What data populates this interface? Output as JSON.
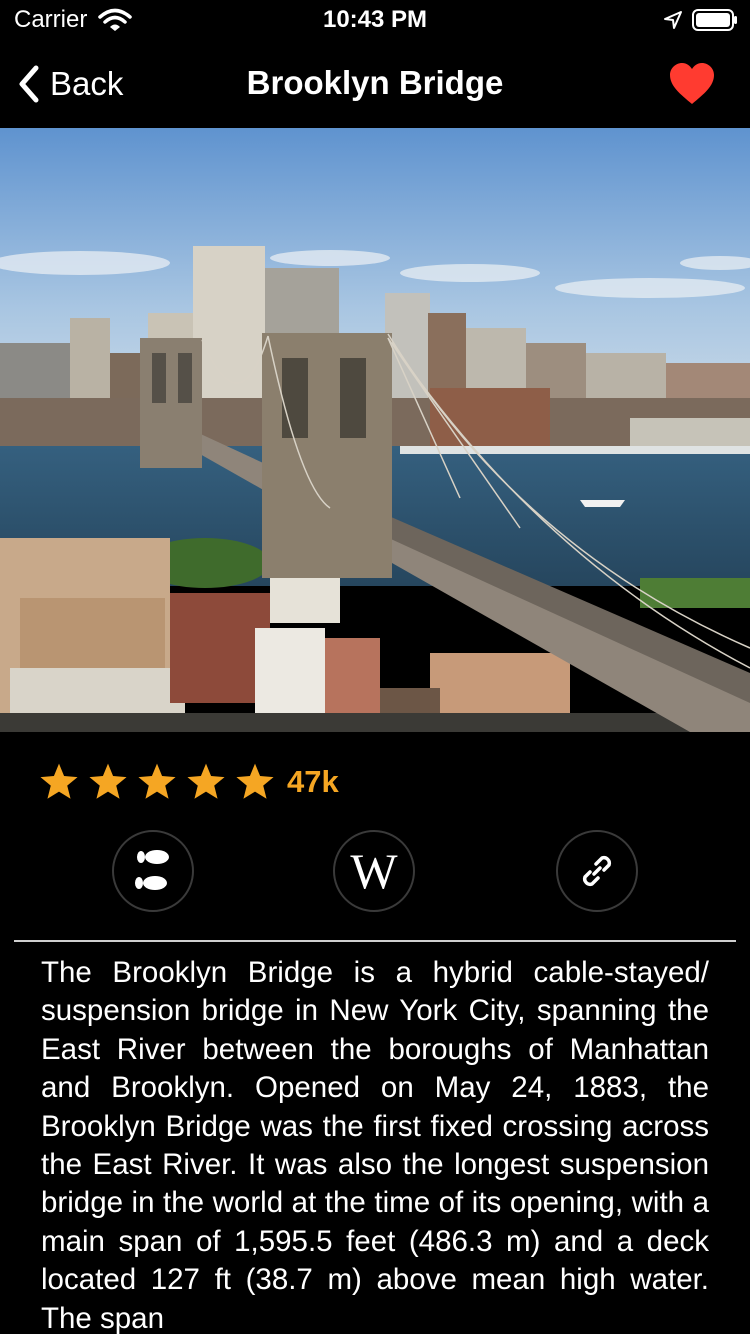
{
  "status_bar": {
    "carrier": "Carrier",
    "time": "10:43 PM"
  },
  "nav": {
    "back_label": "Back",
    "title": "Brooklyn Bridge",
    "favorite_color": "#ff3b30"
  },
  "hero": {
    "subject": "Brooklyn Bridge over the East River with city skyline"
  },
  "rating": {
    "stars": 5,
    "count_label": "47k",
    "color": "#f5a623"
  },
  "actions": {
    "walk_icon": "footprints-icon",
    "wiki_glyph": "W",
    "link_icon": "link-icon"
  },
  "description": "The Brooklyn Bridge is a hybrid cable-stayed/ suspension bridge in New York City, spanning the East River between the boroughs of Manhattan and Brooklyn. Opened on May 24, 1883, the Brooklyn Bridge was the first fixed crossing across the East River. It was also the longest suspension bridge in the world at the time of its opening, with a main span of 1,595.5 feet (486.3 m) and a deck located 127 ft (38.7 m) above mean high water. The span"
}
